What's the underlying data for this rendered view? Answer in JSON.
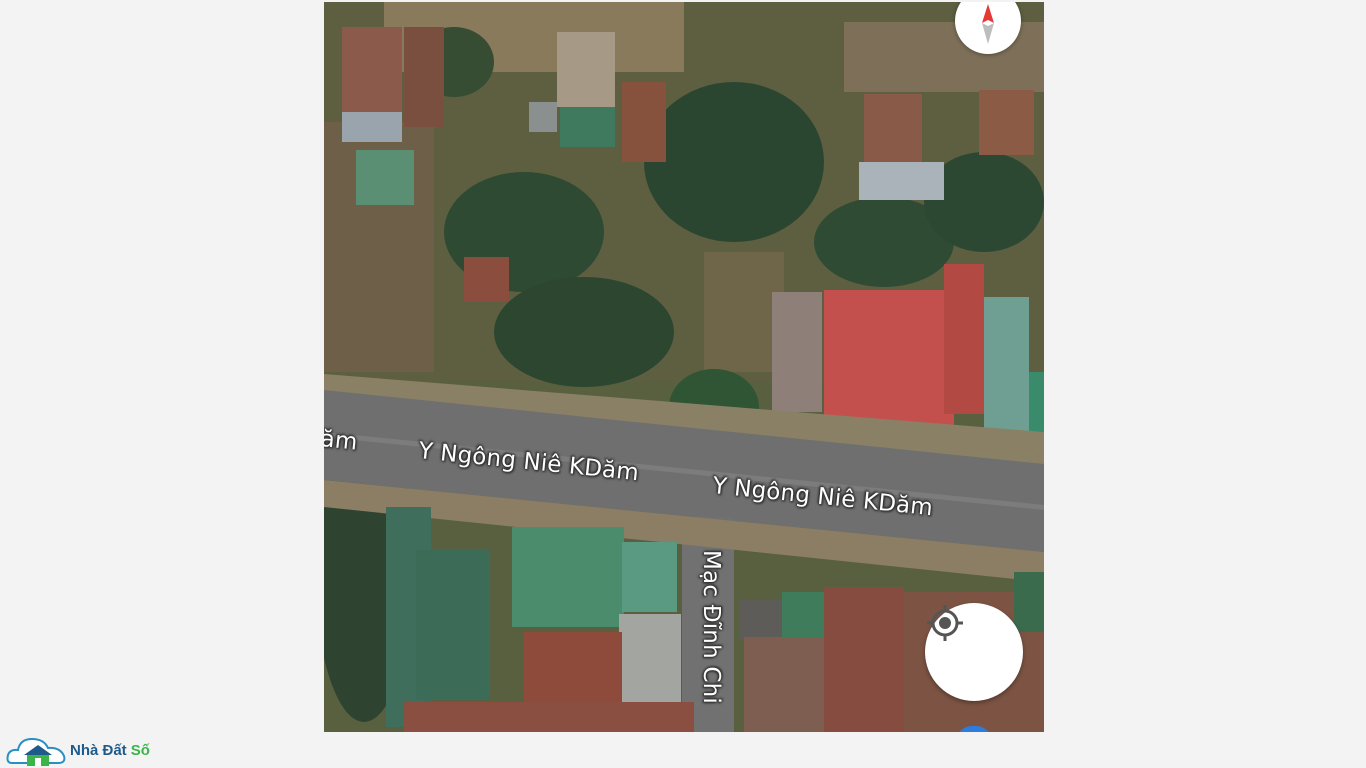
{
  "map": {
    "view": "satellite",
    "roads": {
      "main_label_left_partial": "ăm",
      "main_label_1": "Y Ngông Niê KDăm",
      "main_label_2": "Y Ngông Niê KDăm",
      "side_label": "Mạc Đĩnh Chi"
    },
    "controls": {
      "compass_icon": "compass-icon",
      "locate_icon": "my-location-icon"
    },
    "colors": {
      "label_text": "#ffffff",
      "control_bg": "#ffffff",
      "compass_north": "#e53935",
      "location_dot": "#2d7de0"
    }
  },
  "watermark": {
    "text_part1": "Nhà Đất",
    "text_part2": "Số",
    "icon": "house-cloud-logo-icon",
    "color_part1": "#1e5b8a",
    "color_part2": "#3bb54a"
  }
}
